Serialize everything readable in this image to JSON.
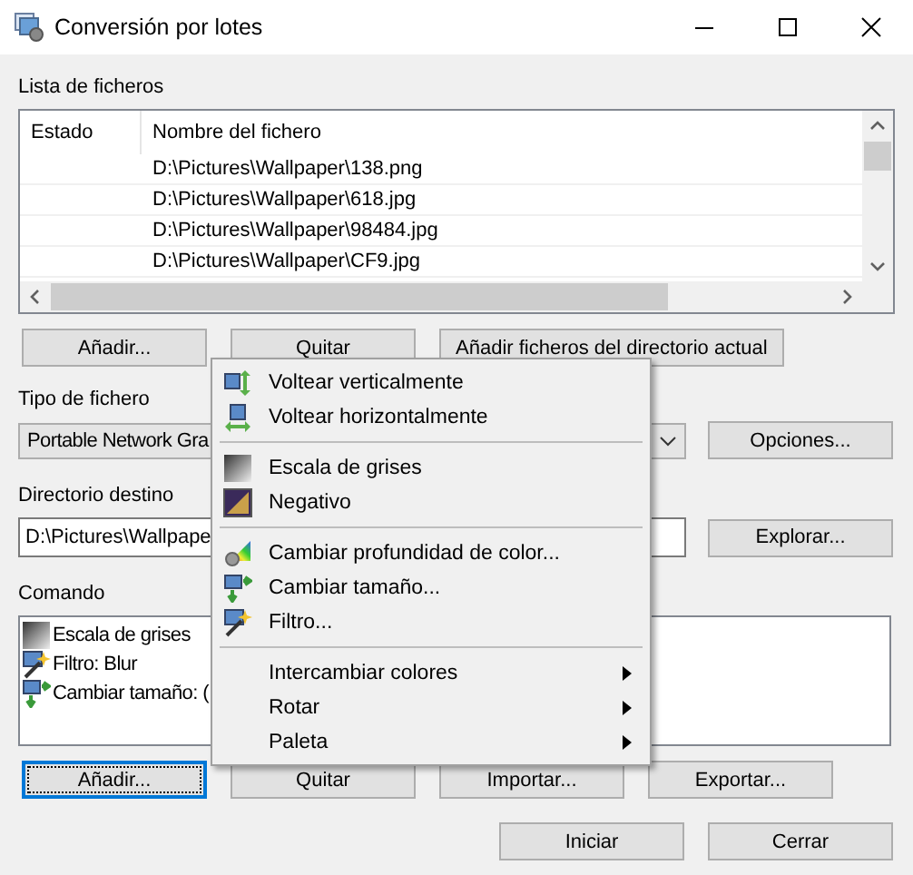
{
  "window": {
    "title": "Conversión por lotes"
  },
  "file_list": {
    "label": "Lista de ficheros",
    "columns": [
      "Estado",
      "Nombre del fichero"
    ],
    "rows": [
      {
        "status": "",
        "name": "D:\\Pictures\\Wallpaper\\138.png"
      },
      {
        "status": "",
        "name": "D:\\Pictures\\Wallpaper\\618.jpg"
      },
      {
        "status": "",
        "name": "D:\\Pictures\\Wallpaper\\98484.jpg"
      },
      {
        "status": "",
        "name": "D:\\Pictures\\Wallpaper\\CF9.jpg"
      }
    ]
  },
  "file_buttons": [
    {
      "label": "Añadir...",
      "focused": false
    },
    {
      "label": "Quitar",
      "focused": false
    },
    {
      "label": "Añadir ficheros del directorio actual",
      "focused": false
    }
  ],
  "file_type": {
    "label": "Tipo de fichero",
    "value": "Portable Network Gra",
    "button": "Opciones..."
  },
  "destination": {
    "label": "Directorio destino",
    "value": "D:\\Pictures\\Wallpape",
    "button": "Explorar..."
  },
  "commands": {
    "label": "Comando",
    "items": [
      {
        "kind": "grayscale",
        "text": "Escala de grises"
      },
      {
        "kind": "filter",
        "text": "Filtro: Blur"
      },
      {
        "kind": "resize",
        "text": "Cambiar tamaño: ("
      }
    ]
  },
  "command_buttons": [
    {
      "label": "Añadir...",
      "focused": true
    },
    {
      "label": "Quitar",
      "focused": false
    },
    {
      "label": "Importar...",
      "focused": false
    },
    {
      "label": "Exportar...",
      "focused": false
    }
  ],
  "dialog_buttons": [
    {
      "label": "Iniciar",
      "focused": false
    },
    {
      "label": "Cerrar",
      "focused": false
    }
  ],
  "context_menu": {
    "groups": [
      [
        {
          "kind": "flip-vertical",
          "label": "Voltear verticalmente",
          "submenu": false
        },
        {
          "kind": "flip-horizontal",
          "label": "Voltear horizontalmente",
          "submenu": false
        }
      ],
      [
        {
          "kind": "grayscale",
          "label": "Escala de grises",
          "submenu": false
        },
        {
          "kind": "negative",
          "label": "Negativo",
          "submenu": false
        }
      ],
      [
        {
          "kind": "color-depth",
          "label": "Cambiar profundidad de color...",
          "submenu": false
        },
        {
          "kind": "resize",
          "label": "Cambiar tamaño...",
          "submenu": false
        },
        {
          "kind": "filter",
          "label": "Filtro...",
          "submenu": false
        }
      ],
      [
        {
          "kind": "plain",
          "label": "Intercambiar colores",
          "submenu": true
        },
        {
          "kind": "plain",
          "label": "Rotar",
          "submenu": true
        },
        {
          "kind": "plain",
          "label": "Paleta",
          "submenu": true
        }
      ]
    ]
  }
}
